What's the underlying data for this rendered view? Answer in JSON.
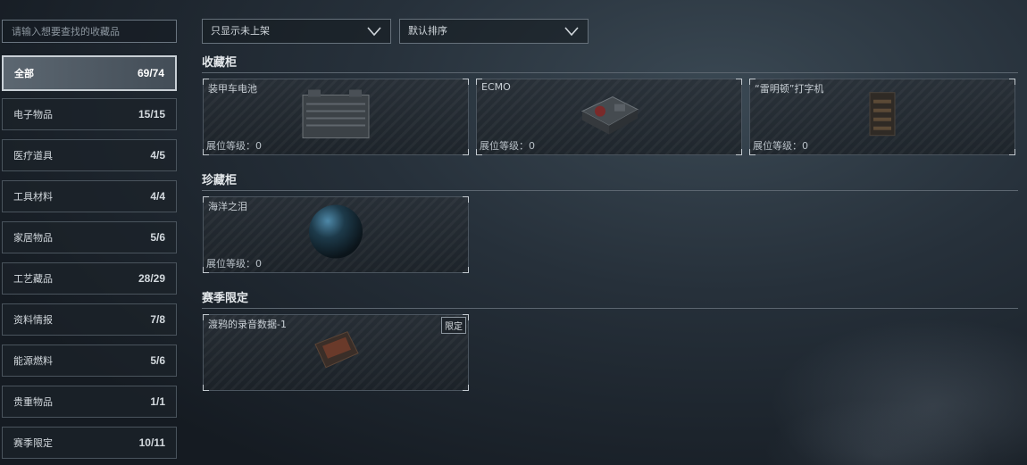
{
  "search": {
    "placeholder": "请输入想要查找的收藏品"
  },
  "categories": [
    {
      "label": "全部",
      "count": "69/74"
    },
    {
      "label": "电子物品",
      "count": "15/15"
    },
    {
      "label": "医疗道具",
      "count": "4/5"
    },
    {
      "label": "工具材料",
      "count": "4/4"
    },
    {
      "label": "家居物品",
      "count": "5/6"
    },
    {
      "label": "工艺藏品",
      "count": "28/29"
    },
    {
      "label": "资料情报",
      "count": "7/8"
    },
    {
      "label": "能源燃料",
      "count": "5/6"
    },
    {
      "label": "贵重物品",
      "count": "1/1"
    },
    {
      "label": "赛季限定",
      "count": "10/11"
    }
  ],
  "filters": {
    "display": "只显示未上架",
    "sort": "默认排序"
  },
  "sections": [
    {
      "title": "收藏柜",
      "items": [
        {
          "name": "装甲车电池",
          "level": "展位等级：0",
          "icon": "battery-icon"
        },
        {
          "name": "ECMO",
          "level": "展位等级：0",
          "icon": "ecmo-machine-icon"
        },
        {
          "name": "“雷明顿”打字机",
          "level": "展位等级：0",
          "icon": "typewriter-icon"
        }
      ]
    },
    {
      "title": "珍藏柜",
      "items": [
        {
          "name": "海洋之泪",
          "level": "展位等级：0",
          "icon": "gem-icon"
        }
      ]
    },
    {
      "title": "赛季限定",
      "items": [
        {
          "name": "渡鸦的录音数据-1",
          "tag": "限定",
          "icon": "data-chip-icon"
        }
      ]
    }
  ]
}
